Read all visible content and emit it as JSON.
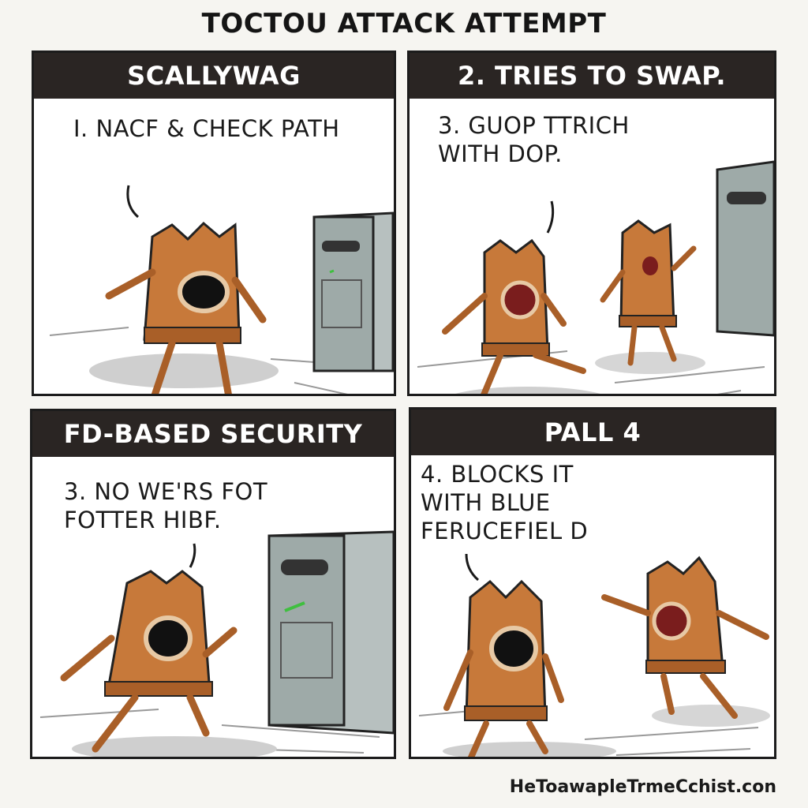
{
  "title": "TOCTOU ATTACK ATTEMPT",
  "panels": [
    {
      "header": "SCALLYWAG",
      "caption": "I. NACF & CHECK PATH"
    },
    {
      "header": "2.  TRIES TO SWAP.",
      "caption": "3. GUOP TTRICH\nWITH DOP."
    },
    {
      "header": "FD-BASED SECURITY",
      "caption": "3. NO WE'RS FOT\nFOTTER HIBF."
    },
    {
      "header": "PALL 4",
      "caption": "4. BLOCKS  IT\nWITH BLUE\nFERUCEFIEL D"
    }
  ],
  "signature": "HeToawapleTrmeCchist.con",
  "colors": {
    "header_bg": "#2a2523",
    "character_body": "#c7793a",
    "server": "#9eaaa8"
  }
}
